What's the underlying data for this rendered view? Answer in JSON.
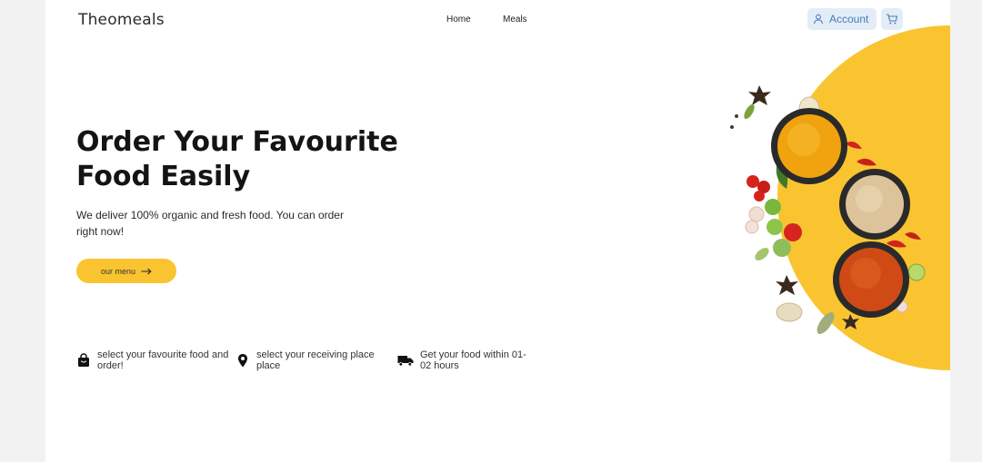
{
  "header": {
    "logo": "Theomeals",
    "nav": [
      "Home",
      "Meals"
    ],
    "account_label": "Account",
    "cart_icon": "cart-icon",
    "user_icon": "user-icon"
  },
  "hero": {
    "headline_line1": "Order Your Favourite",
    "headline_line2": "Food Easily",
    "subtext": "We deliver 100% organic and fresh food. You can order right now!",
    "cta_label": "our menu",
    "cta_icon": "arrow-right-icon"
  },
  "features": [
    {
      "icon": "shopping-bag-icon",
      "text": "select your favourite food and order!"
    },
    {
      "icon": "location-pin-icon",
      "text": "select your receiving place place"
    },
    {
      "icon": "truck-icon",
      "text": "Get your food within 01-02 hours"
    }
  ],
  "colors": {
    "accent": "#f9c430",
    "account_bg": "#e3edf7",
    "account_text": "#4a7bbd"
  }
}
